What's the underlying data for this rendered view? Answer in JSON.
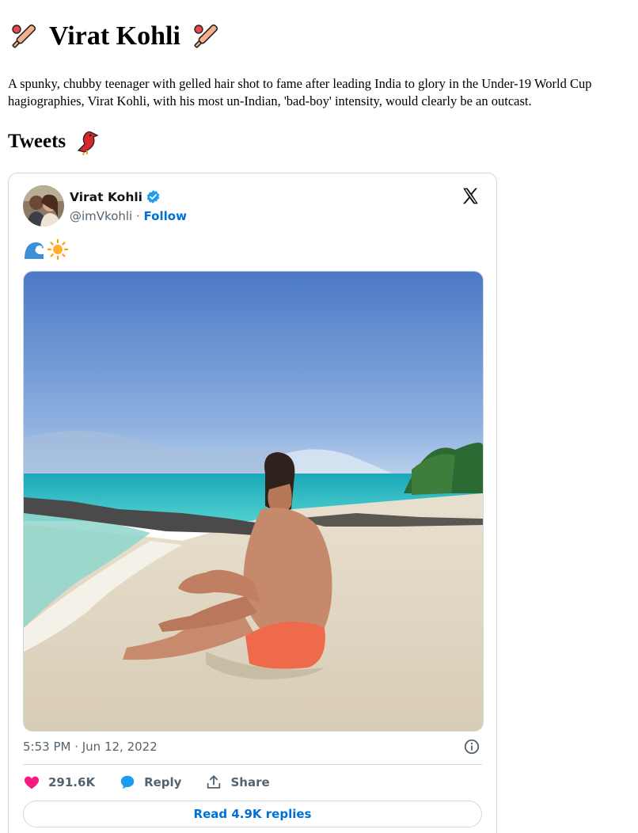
{
  "heading": "Virat Kohli",
  "intro": {
    "line1": "A spunky, chubby teenager with gelled hair shot to fame after leading India to glory in the Under-19 World Cup",
    "line2": "hagiographies, Virat Kohli, with his most un-Indian, 'bad-boy' intensity, would clearly be an outcast."
  },
  "tweets_heading": "Tweets",
  "tweet": {
    "author_name": "Virat Kohli",
    "handle": "@imVkohli",
    "separator": " · ",
    "follow_label": "Follow",
    "text_icons": [
      "wave-icon",
      "sun-icon"
    ],
    "timestamp": "5:53 PM · Jun 12, 2022",
    "likes": "291.6K",
    "reply_label": "Reply",
    "share_label": "Share",
    "read_replies_label": "Read 4.9K replies"
  },
  "colors": {
    "link_blue": "#006fd6",
    "like_pink": "#f91880",
    "verified_blue": "#1d9bf0",
    "muted_text": "#536471",
    "border": "#cfd9de"
  }
}
